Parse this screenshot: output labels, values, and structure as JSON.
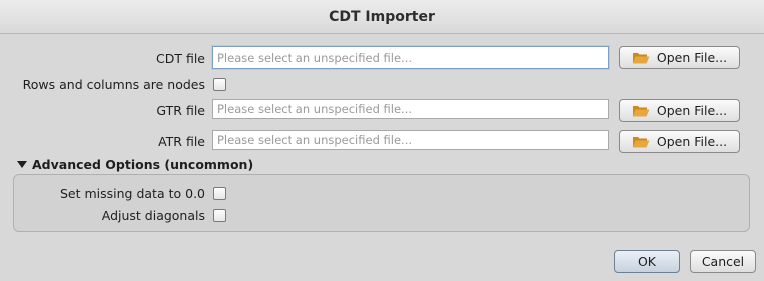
{
  "window": {
    "title": "CDT Importer"
  },
  "cdt": {
    "label": "CDT file",
    "placeholder": "Please select an unspecified file...",
    "button": "Open File..."
  },
  "nodes": {
    "label": "Rows and columns are nodes",
    "checked": false
  },
  "gtr": {
    "label": "GTR file",
    "placeholder": "Please select an unspecified file...",
    "button": "Open File..."
  },
  "atr": {
    "label": "ATR file",
    "placeholder": "Please select an unspecified file...",
    "button": "Open File..."
  },
  "advanced": {
    "title": "Advanced Options (uncommon)",
    "missing": {
      "label": "Set missing data to 0.0",
      "checked": false
    },
    "diagonals": {
      "label": "Adjust diagonals",
      "checked": false
    }
  },
  "footer": {
    "ok": "OK",
    "cancel": "Cancel"
  },
  "icons": {
    "open": "folder-open-icon",
    "toggle": "triangle-down-icon"
  },
  "colors": {
    "folder": "#e8a73a",
    "focus": "#7aa0c8"
  }
}
